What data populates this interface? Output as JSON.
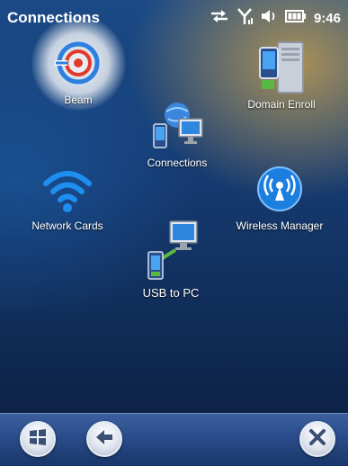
{
  "status_bar": {
    "title": "Connections",
    "time": "9:46"
  },
  "icons": [
    {
      "id": "beam",
      "label": "Beam"
    },
    {
      "id": "domain-enroll",
      "label": "Domain Enroll"
    },
    {
      "id": "connections",
      "label": "Connections"
    },
    {
      "id": "network-cards",
      "label": "Network Cards"
    },
    {
      "id": "wireless-manager",
      "label": "Wireless Manager"
    },
    {
      "id": "usb-to-pc",
      "label": "USB to PC"
    }
  ],
  "colors": {
    "accent_blue": "#2d7fe0",
    "beam_red": "#e3392b",
    "usb_green": "#58b840"
  },
  "taskbar": {
    "start_icon": "windows-start-icon",
    "back_icon": "back-arrow-icon",
    "close_icon": "close-icon"
  }
}
